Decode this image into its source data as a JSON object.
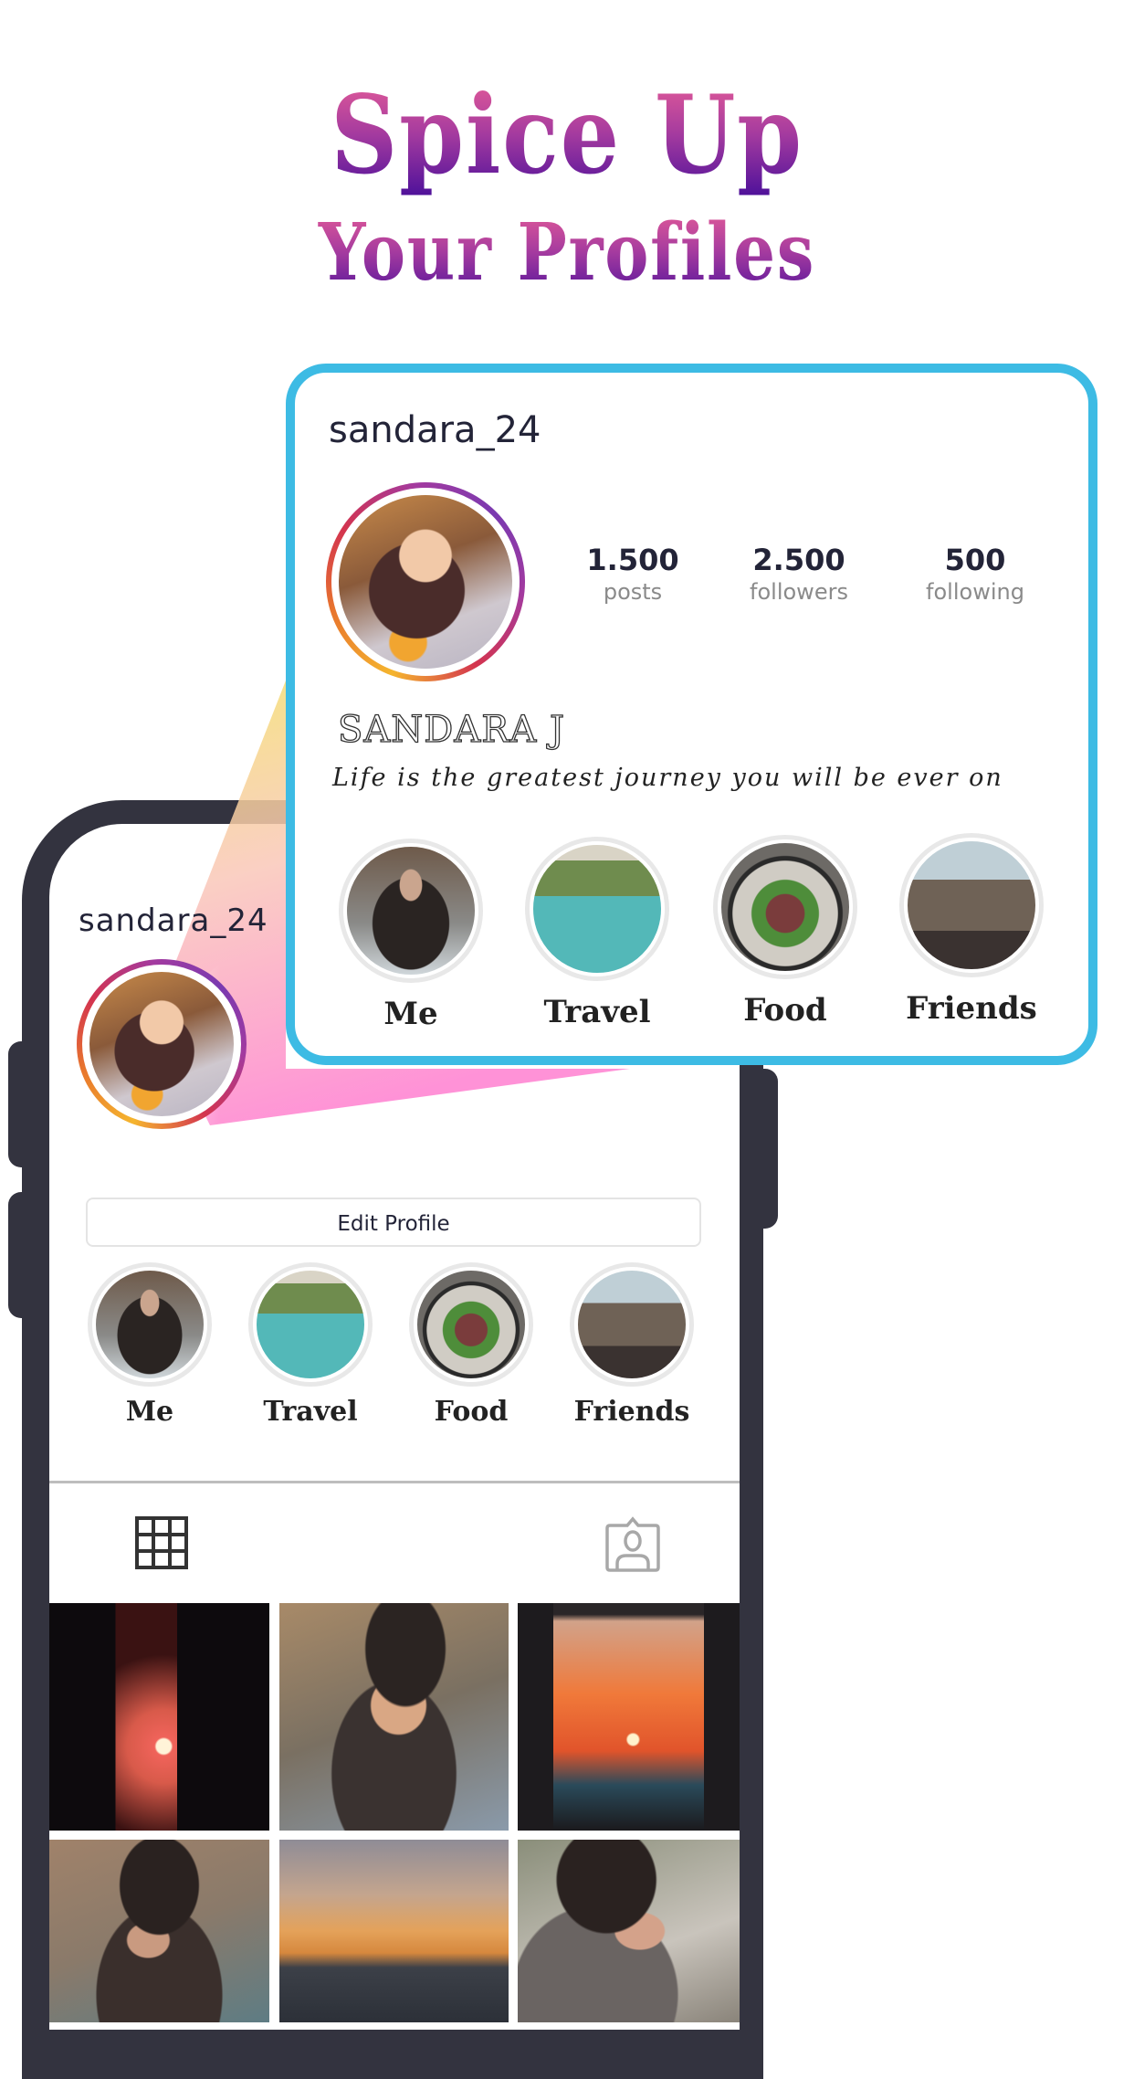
{
  "headline": {
    "line1": "Spice Up",
    "line2": "Your Profiles"
  },
  "colors": {
    "card_border": "#3dbbe4",
    "phone_frame": "#33333f",
    "headline_top": "#ec5f97",
    "headline_bottom": "#4a0f9a",
    "text_dark": "#232438"
  },
  "card": {
    "username": "sandara_24",
    "stats": [
      {
        "value": "1.500",
        "label": "posts"
      },
      {
        "value": "2.500",
        "label": "followers"
      },
      {
        "value": "500",
        "label": "following"
      }
    ],
    "full_name": "SANDARA J",
    "bio": "Life is the greatest journey you will be ever on",
    "highlights": [
      {
        "label": "Me",
        "image": "woman-curly-hair"
      },
      {
        "label": "Travel",
        "image": "infinity-pool"
      },
      {
        "label": "Food",
        "image": "steak-plate"
      },
      {
        "label": "Friends",
        "image": "group-of-friends"
      }
    ]
  },
  "phone": {
    "username": "sandara_24",
    "edit_profile_label": "Edit Profile",
    "highlights": [
      {
        "label": "Me",
        "image": "woman-curly-hair"
      },
      {
        "label": "Travel",
        "image": "infinity-pool"
      },
      {
        "label": "Food",
        "image": "steak-plate"
      },
      {
        "label": "Friends",
        "image": "group-of-friends"
      }
    ],
    "tabs": [
      {
        "icon": "grid-icon",
        "active": true
      },
      {
        "icon": "tagged-person-icon",
        "active": false
      }
    ],
    "posts": [
      {
        "image": "city-sunset"
      },
      {
        "image": "woman-beanie-smiling"
      },
      {
        "image": "sunset-window"
      },
      {
        "image": "woman-beanie-sunglasses"
      },
      {
        "image": "mountain-dusk"
      },
      {
        "image": "woman-sunglasses-closeup"
      }
    ]
  }
}
